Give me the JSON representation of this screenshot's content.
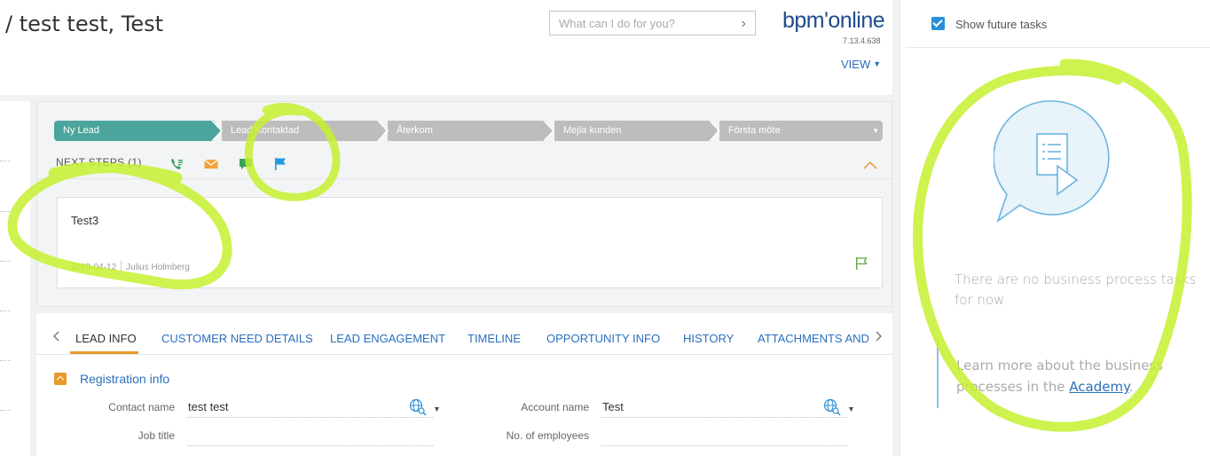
{
  "header": {
    "title": "/ test test, Test",
    "search_placeholder": "What can I do for you?",
    "logo": "bpm'online",
    "version": "7.13.4.638",
    "view_label": "VIEW"
  },
  "stages": [
    {
      "label": "Ny Lead",
      "active": true
    },
    {
      "label": "Lead Kontaktad",
      "active": false
    },
    {
      "label": "Återkom",
      "active": false
    },
    {
      "label": "Mejla kunden",
      "active": false
    },
    {
      "label": "Första möte",
      "active": false
    }
  ],
  "next_steps": {
    "label": "NEXT STEPS (1)",
    "icons": [
      "call-icon",
      "email-icon",
      "chat-icon",
      "flag-icon"
    ]
  },
  "task": {
    "title": "Test3",
    "date": "2019-04-12",
    "owner": "Julius Holmberg"
  },
  "tabs": [
    "LEAD INFO",
    "CUSTOMER NEED DETAILS",
    "LEAD ENGAGEMENT",
    "TIMELINE",
    "OPPORTUNITY INFO",
    "HISTORY",
    "ATTACHMENTS AND NOTES"
  ],
  "registration": {
    "title": "Registration info",
    "contact_name_label": "Contact name",
    "contact_name_value": "test test",
    "account_name_label": "Account name",
    "account_name_value": "Test",
    "job_title_label": "Job title",
    "job_title_value": "",
    "employees_label": "No. of employees",
    "employees_value": ""
  },
  "right_panel": {
    "show_future_label": "Show future tasks",
    "show_future_checked": true,
    "empty_text": "There are no business process tasks for now",
    "academy_prefix": "Learn more about the business processes in the ",
    "academy_link": "Academy",
    "academy_suffix": "."
  },
  "colors": {
    "accent": "#2a6fbd",
    "stage_active": "#4ba59c",
    "stage_inactive": "#bdbdbd",
    "orange": "#e79a2b",
    "highlight": "#c6f02f"
  }
}
